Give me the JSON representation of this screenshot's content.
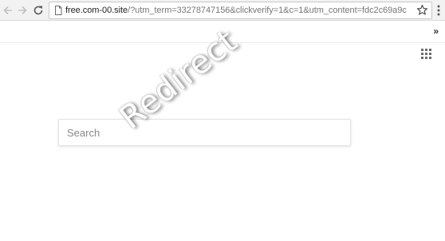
{
  "browser": {
    "url_host": "free.com-00.site",
    "url_path": "/?utm_term=33278747156&clickverify=1&c=1&utm_content=fdc2c69a9c",
    "icons": {
      "back": "back-arrow-icon",
      "forward": "forward-arrow-icon",
      "reload": "reload-icon",
      "page": "page-icon",
      "bookmark": "star-icon",
      "menu": "menu-dots-icon",
      "overflow": "chevron-right-double-icon",
      "apps": "apps-grid-icon"
    },
    "bookmarks_overflow": "»"
  },
  "page": {
    "search_placeholder": "Search",
    "watermark": "Redirect"
  }
}
